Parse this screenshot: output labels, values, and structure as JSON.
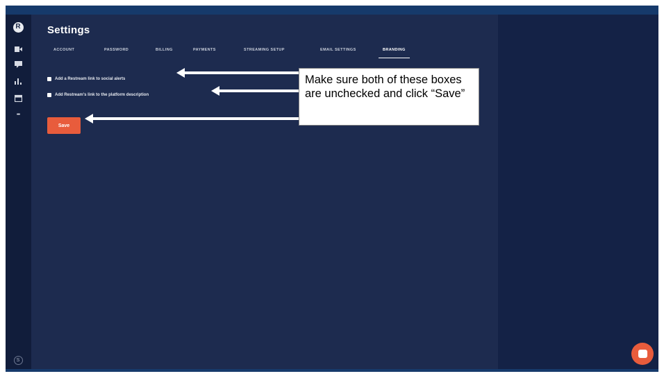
{
  "page": {
    "title": "Settings"
  },
  "sidebar": {
    "items": [
      {
        "icon": "restream-logo-icon",
        "glyph": "R"
      },
      {
        "icon": "video-camera-icon",
        "glyph": "■"
      },
      {
        "icon": "chat-icon",
        "glyph": "▾"
      },
      {
        "icon": "analytics-icon",
        "glyph": "ıl"
      },
      {
        "icon": "calendar-icon",
        "glyph": "▣"
      },
      {
        "icon": "more-icon",
        "glyph": "•••"
      }
    ],
    "user_badge": "S"
  },
  "tabs": [
    {
      "label": "ACCOUNT",
      "active": false
    },
    {
      "label": "PASSWORD",
      "active": false
    },
    {
      "label": "BILLING",
      "active": false
    },
    {
      "label": "PAYMENTS",
      "active": false
    },
    {
      "label": "STREAMING SETUP",
      "active": false
    },
    {
      "label": "EMAIL SETTINGS",
      "active": false
    },
    {
      "label": "BRANDING",
      "active": true
    }
  ],
  "options": [
    {
      "label": "Add a Restream link to social alerts",
      "checked": true
    },
    {
      "label": "Add Restream's link to the platform description",
      "checked": true
    }
  ],
  "save_label": "Save",
  "annotation": {
    "text": "Make sure both of these boxes are unchecked and click “Save”"
  },
  "colors": {
    "background": "#1d2b4f",
    "sidebar": "#111d3b",
    "accent": "#e85c3c",
    "right_panel": "#142246"
  }
}
